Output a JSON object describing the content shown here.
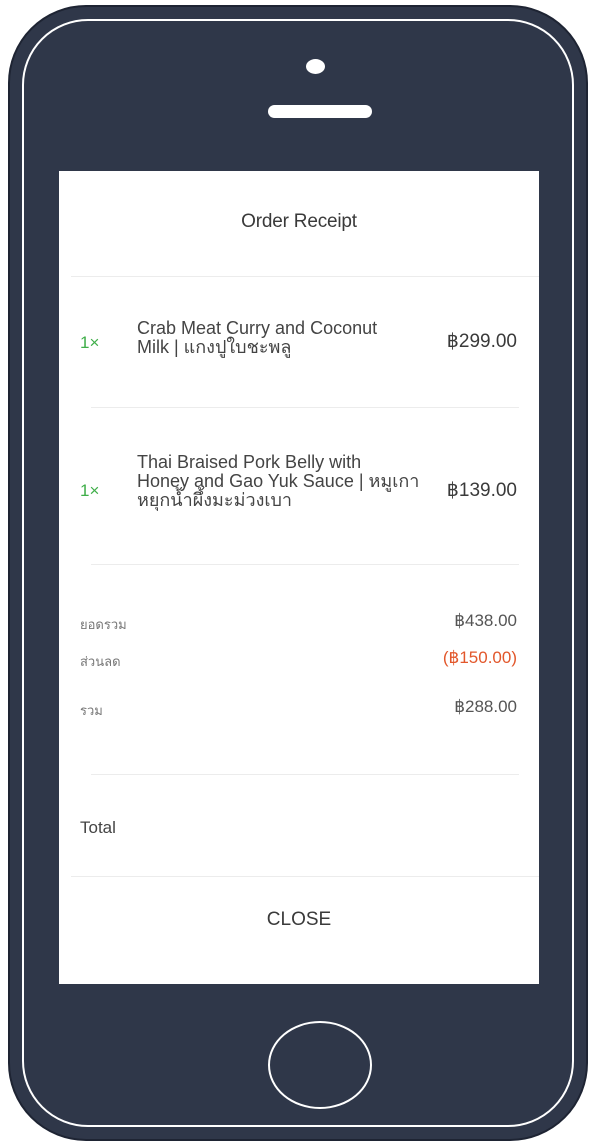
{
  "receipt": {
    "title": "Order Receipt",
    "items": [
      {
        "qty": "1×",
        "name_line1": "Crab Meat Curry and Coconut",
        "name_line2": "Milk | แกงปูใบชะพลู",
        "price": "฿299.00"
      },
      {
        "qty": "1×",
        "name_line1": "Thai Braised Pork Belly with",
        "name_line2": "Honey and Gao Yuk Sauce | หมูเกา",
        "name_line3": "หยุกน้ำผึ้งมะม่วงเบา",
        "price": "฿139.00"
      }
    ],
    "summary": [
      {
        "label": "ยอดรวม",
        "value": "฿438.00"
      },
      {
        "label": "ส่วนลด",
        "value": "(฿150.00)"
      },
      {
        "label": "รวม",
        "value": "฿288.00"
      }
    ],
    "total_label": "Total",
    "close_label": "CLOSE"
  },
  "colors": {
    "phone_body": "#2f3749",
    "quantity": "#3fae49",
    "discount": "#e2572b"
  }
}
